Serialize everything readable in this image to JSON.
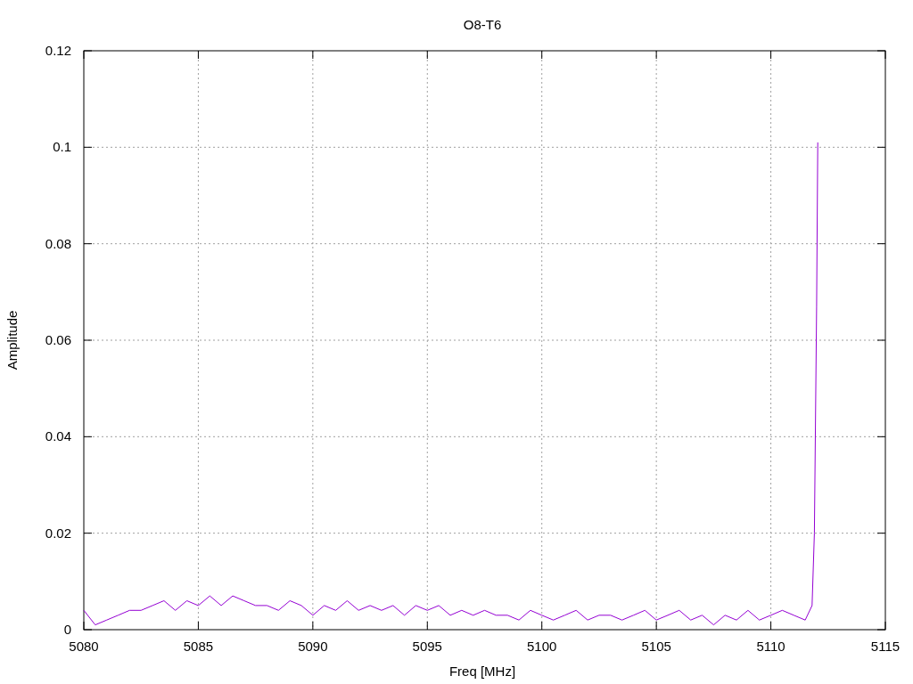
{
  "chart_data": {
    "type": "line",
    "title": "O8-T6",
    "xlabel": "Freq [MHz]",
    "ylabel": "Amplitude",
    "grid": true,
    "xlim": [
      5080,
      5115
    ],
    "ylim": [
      0,
      0.12
    ],
    "xticks": [
      5080,
      5085,
      5090,
      5095,
      5100,
      5105,
      5110,
      5115
    ],
    "yticks": [
      {
        "value": 0,
        "label": "0"
      },
      {
        "value": 0.02,
        "label": "0.02"
      },
      {
        "value": 0.04,
        "label": "0.04"
      },
      {
        "value": 0.06,
        "label": "0.06"
      },
      {
        "value": 0.08,
        "label": "0.08"
      },
      {
        "value": 0.1,
        "label": "0.1"
      },
      {
        "value": 0.12,
        "label": "0.12"
      }
    ],
    "x": [
      5080,
      5080.5,
      5081,
      5081.5,
      5082,
      5082.5,
      5083,
      5083.5,
      5084,
      5084.5,
      5085,
      5085.5,
      5086,
      5086.5,
      5087,
      5087.5,
      5088,
      5088.5,
      5089,
      5089.5,
      5090,
      5090.5,
      5091,
      5091.5,
      5092,
      5092.5,
      5093,
      5093.5,
      5094,
      5094.5,
      5095,
      5095.5,
      5096,
      5096.5,
      5097,
      5097.5,
      5098,
      5098.5,
      5099,
      5099.5,
      5100,
      5100.5,
      5101,
      5101.5,
      5102,
      5102.5,
      5103,
      5103.5,
      5104,
      5104.5,
      5105,
      5105.5,
      5106,
      5106.5,
      5107,
      5107.5,
      5108,
      5108.5,
      5109,
      5109.5,
      5110,
      5110.5,
      5111,
      5111.5,
      5111.8,
      5111.9,
      5112,
      5112.05
    ],
    "series": [
      {
        "color": "#9400d3",
        "values": [
          0.004,
          0.001,
          0.002,
          0.003,
          0.004,
          0.004,
          0.005,
          0.006,
          0.004,
          0.006,
          0.005,
          0.007,
          0.005,
          0.007,
          0.006,
          0.005,
          0.005,
          0.004,
          0.006,
          0.005,
          0.003,
          0.005,
          0.004,
          0.006,
          0.004,
          0.005,
          0.004,
          0.005,
          0.003,
          0.005,
          0.004,
          0.005,
          0.003,
          0.004,
          0.003,
          0.004,
          0.003,
          0.003,
          0.002,
          0.004,
          0.003,
          0.002,
          0.003,
          0.004,
          0.002,
          0.003,
          0.003,
          0.002,
          0.003,
          0.004,
          0.002,
          0.003,
          0.004,
          0.002,
          0.003,
          0.001,
          0.003,
          0.002,
          0.004,
          0.002,
          0.003,
          0.004,
          0.003,
          0.002,
          0.005,
          0.02,
          0.067,
          0.101
        ]
      }
    ]
  }
}
